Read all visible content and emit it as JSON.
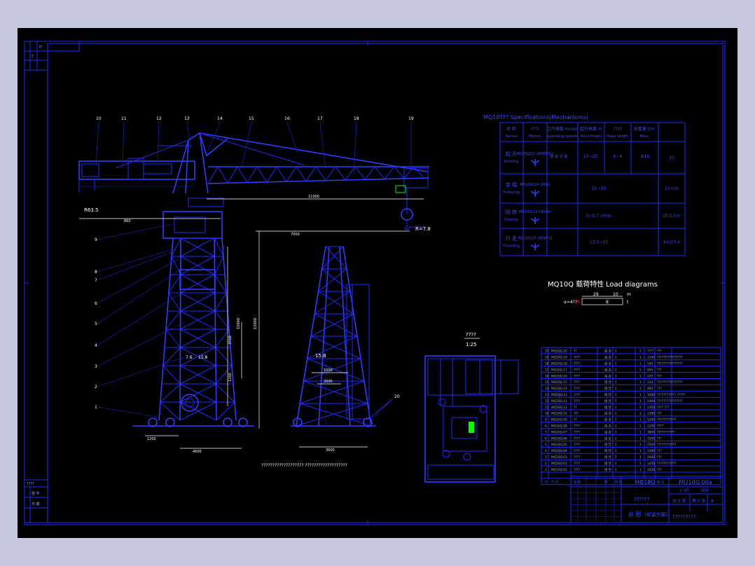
{
  "colors": {
    "background": "#000000",
    "linework": "#1d2bff",
    "text": "#ffffff",
    "frame_outer": "#c5c7e0",
    "highlight": "#00ff00",
    "red": "#ff2020"
  },
  "part_labels": [
    "10",
    "11",
    "12",
    "13",
    "14",
    "15",
    "16",
    "17",
    "18",
    "19",
    "9",
    "8",
    "7",
    "6",
    "5",
    "4",
    "3",
    "2",
    "1",
    "20"
  ],
  "dimensions": {
    "counterweight_arm": "R63.5",
    "boom_length": "11000",
    "rail_span": "7000",
    "radius_note": "R=7.8",
    "tower_height": "12000",
    "hook_height": "15000",
    "base_left": "1200",
    "base_width": "4600",
    "side_base": "3600",
    "side_small": "1000",
    "side_mid": "2000",
    "leg_span_label": "7.6",
    "leg_span_label2": "15.8",
    "section_upper": "3710",
    "section_lower": "1200",
    "section_h": "860"
  },
  "spec_table": {
    "title": "MQ10??? Specifications(Mechanisms)",
    "headers": [
      {
        "cn": "名 称",
        "en": "Names"
      },
      {
        "cn": "????",
        "en": "Motors"
      },
      {
        "cn": "工作速度 m/min",
        "en": "operating speeds"
      },
      {
        "cn": "起升高度 m",
        "en": "Hoist Height"
      },
      {
        "cn": "????",
        "en": "Rope length"
      },
      {
        "cn": "总重量 t/m",
        "en": "Mass"
      }
    ],
    "rows": [
      {
        "cn": "起 升",
        "en": "Hoisting",
        "motor": "MQ10Q/22 (4KRDQ2)",
        "speed_sub": "重 载 空 载",
        "speed": "10~25",
        "height": "6~4",
        "rope": "ф16",
        "mass": "10"
      },
      {
        "cn": "变 幅",
        "en": "Trolleying",
        "motor": "MQ10Q/24 (2KW)",
        "speed": "15~30",
        "height": "",
        "rope": "",
        "mass": "15 t·m"
      },
      {
        "cn": "回 转",
        "en": "Slewing",
        "motor": "MQ10Q/23 (SKW6)",
        "speed": "0~0.7 r/min",
        "height": "",
        "rope": "",
        "mass": "25.5 t·m"
      },
      {
        "cn": "行 走",
        "en": "Travelling",
        "motor": "MQ10Q/25 (4KW*2)",
        "speed": "12.5~25",
        "height": "",
        "rope": "",
        "mass": "4×2/3.4"
      }
    ]
  },
  "load_diagram": {
    "title_cn": "MQ10Q 载荷特性",
    "title_en": "Load diagrams",
    "top_left": "29",
    "top_right": "10",
    "unit_m": "m",
    "bar_value": "8",
    "left_note": "α=4??",
    "red_mark": "Pt",
    "unit_t": "t"
  },
  "section_view": {
    "title": "????",
    "scale": "1:25"
  },
  "centre_caption": "??????????????????? ???????????????????",
  "bom_table": {
    "header": [
      "序",
      "代 号",
      "名 称",
      "数",
      "材 料",
      "单",
      "总",
      "备 注"
    ],
    "rows": [
      [
        "20",
        "MQ10Q.20",
        "??",
        "1",
        "组 合",
        "1",
        "????",
        "???"
      ],
      [
        "19",
        "MQ10Q.19",
        "????",
        "1",
        "组 合",
        "1",
        "1100",
        "????????????????"
      ],
      [
        "18",
        "MQ10Q.18",
        "????",
        "1",
        "组 合",
        "1",
        "500",
        "????????????????"
      ],
      [
        "17",
        "MQ10Q.17",
        "????",
        "1",
        "组 合",
        "1",
        "950",
        "???"
      ],
      [
        "16",
        "MQ10Q.16",
        "????",
        "1",
        "组 合",
        "1",
        "220",
        "???"
      ],
      [
        "15",
        "MQ10Q.15",
        "????",
        "1",
        "组 合",
        "1",
        "310",
        "????????????????"
      ],
      [
        "14",
        "MQ10Q.14",
        "????",
        "1",
        "组 合",
        "1",
        "460",
        "???"
      ],
      [
        "13",
        "MQ10Q.13",
        "????",
        "1",
        "组 合",
        "1",
        "1600",
        "???????????? ?????"
      ],
      [
        "12",
        "MQ10Q.12",
        "????",
        "1",
        "组 合",
        "1",
        "2400",
        "????????????????"
      ],
      [
        "11",
        "MQ10Q.11",
        "??",
        "1",
        "组 合",
        "1",
        "1350",
        "???? ???"
      ],
      [
        "10",
        "MQ10Q.10",
        "???",
        "1",
        "组 合",
        "1",
        "1300",
        "???"
      ],
      [
        "9",
        "MQ10Q.09",
        "??",
        "1",
        "组 合",
        "1",
        "5200",
        "????????????"
      ],
      [
        "8",
        "MQ10Q.08",
        "????",
        "1",
        "组 合",
        "1",
        "1250",
        "????"
      ],
      [
        "7",
        "MQ10Q.07",
        "????",
        "1",
        "组 合",
        "1",
        "3800",
        "???????????"
      ],
      [
        "6",
        "MQ10Q.06",
        "????",
        "1",
        "组 合",
        "1",
        "1500",
        "???"
      ],
      [
        "5",
        "MQ10Q.05",
        "????",
        "1",
        "组 合",
        "1",
        "2550",
        "????????????"
      ],
      [
        "4",
        "MQ10Q.04",
        "????",
        "1",
        "组 合",
        "1",
        "3300",
        "???"
      ],
      [
        "3",
        "MQ10Q.03",
        "????",
        "1",
        "组 合",
        "1",
        "1640",
        "???"
      ],
      [
        "2",
        "MQ10Q.02",
        "????",
        "1",
        "组 合",
        "1",
        "1450",
        "????????????"
      ],
      [
        "1",
        "MQ10Q.01",
        "????",
        "1",
        "组 合",
        "1",
        "1630",
        "???"
      ]
    ]
  },
  "title_block": {
    "model": "MQ10Q",
    "drawing_no": "MQ10Q.00a",
    "scale": "1:50",
    "weight": "300",
    "company": "??????",
    "drawing_title": "总 图",
    "drawing_subtitle": "(安装方案)",
    "school": "?????????",
    "sheet_a": "共 1 张",
    "sheet_b": "第 1 张",
    "rev": "A"
  },
  "margin_stamp": {
    "top_cells": [
      "??",
      "?"
    ],
    "bottom_label": "????",
    "bottom_cells": [
      "签 字",
      "日 期"
    ]
  }
}
